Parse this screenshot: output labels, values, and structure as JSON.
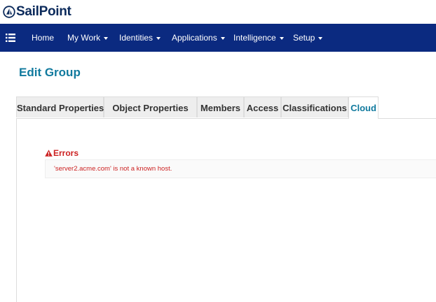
{
  "brand": {
    "name": "SailPoint",
    "color": "#0b2a5b"
  },
  "navbar": {
    "background": "#0b2a80",
    "menu_icon": "hamburger-icon",
    "items": [
      {
        "label": "Home",
        "dropdown": false
      },
      {
        "label": "My Work",
        "dropdown": true
      },
      {
        "label": "Identities",
        "dropdown": true
      },
      {
        "label": "Applications",
        "dropdown": true
      },
      {
        "label": "Intelligence",
        "dropdown": true
      },
      {
        "label": "Setup",
        "dropdown": true
      }
    ]
  },
  "page": {
    "title": "Edit Group",
    "title_color": "#117a9e"
  },
  "tabs": {
    "items": [
      {
        "label": "Standard Properties"
      },
      {
        "label": "Object Properties"
      },
      {
        "label": "Members"
      },
      {
        "label": "Access"
      },
      {
        "label": "Classifications"
      },
      {
        "label": "Cloud"
      }
    ],
    "active": "Cloud"
  },
  "errors": {
    "heading": "Errors",
    "icon": "warning-icon",
    "color": "#cc2222",
    "messages": [
      "'server2.acme.com' is not a known host."
    ]
  }
}
